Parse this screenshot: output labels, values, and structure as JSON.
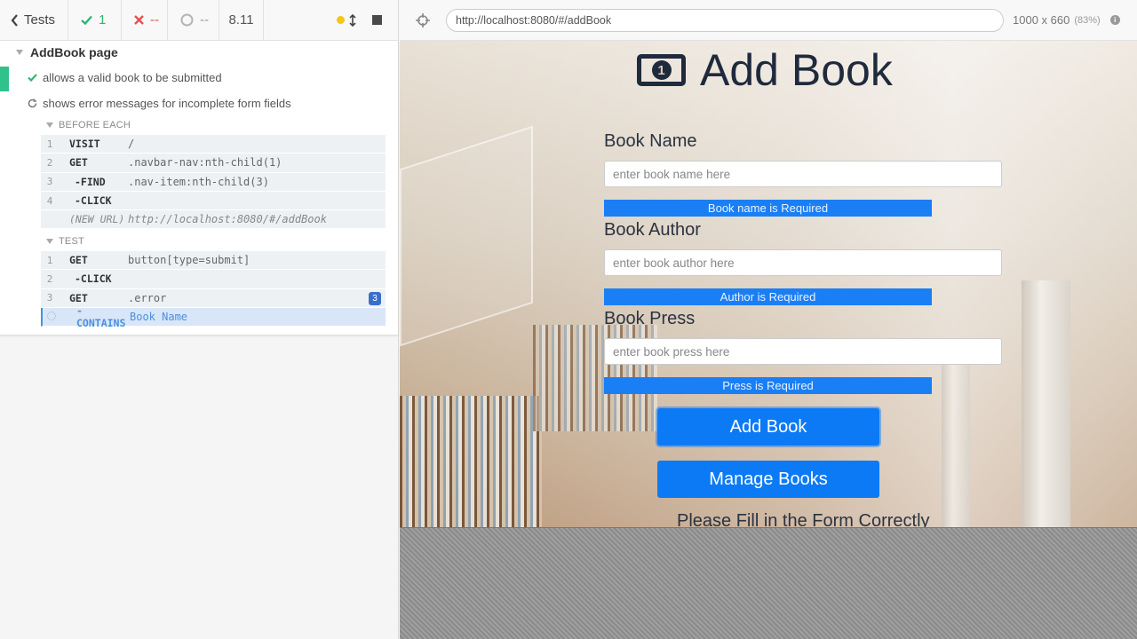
{
  "reporter": {
    "tests_label": "Tests",
    "passed": "1",
    "failed": "--",
    "pending": "--",
    "duration": "8.11",
    "suite_title": "AddBook page",
    "tests": [
      {
        "title": "allows a valid book to be submitted",
        "state": "passed"
      },
      {
        "title": "shows error messages for incomplete form fields",
        "state": "running"
      }
    ],
    "before_each": {
      "label": "BEFORE EACH",
      "commands": [
        {
          "num": "1",
          "name": "VISIT",
          "msg": "/"
        },
        {
          "num": "2",
          "name": "GET",
          "msg": ".navbar-nav:nth-child(1)"
        },
        {
          "num": "3",
          "name": "-FIND",
          "msg": ".nav-item:nth-child(3)"
        },
        {
          "num": "4",
          "name": "-CLICK",
          "msg": ""
        },
        {
          "num": "",
          "name": "(NEW URL)",
          "msg": "http://localhost:8080/#/addBook"
        }
      ]
    },
    "test_hook": {
      "label": "TEST",
      "commands": [
        {
          "num": "1",
          "name": "GET",
          "msg": "button[type=submit]"
        },
        {
          "num": "2",
          "name": "-CLICK",
          "msg": ""
        },
        {
          "num": "3",
          "name": "GET",
          "msg": ".error",
          "badge": "3"
        },
        {
          "num": "",
          "name": "-CONTAINS",
          "msg": "Book Name"
        }
      ]
    }
  },
  "aut": {
    "url": "http://localhost:8080/#/addBook",
    "viewport": "1000 x 660",
    "scale": "(83%)",
    "page": {
      "title": "Add Book",
      "icon_text": "1",
      "fields": [
        {
          "label": "Book Name",
          "placeholder": "enter book name here",
          "error": "Book name is Required"
        },
        {
          "label": "Book Author",
          "placeholder": "enter book author here",
          "error": "Author is Required"
        },
        {
          "label": "Book Press",
          "placeholder": "enter book press here",
          "error": "Press is Required"
        }
      ],
      "add_button": "Add Book",
      "manage_button": "Manage Books",
      "footer_message": "Please Fill in the Form Correctly"
    }
  }
}
